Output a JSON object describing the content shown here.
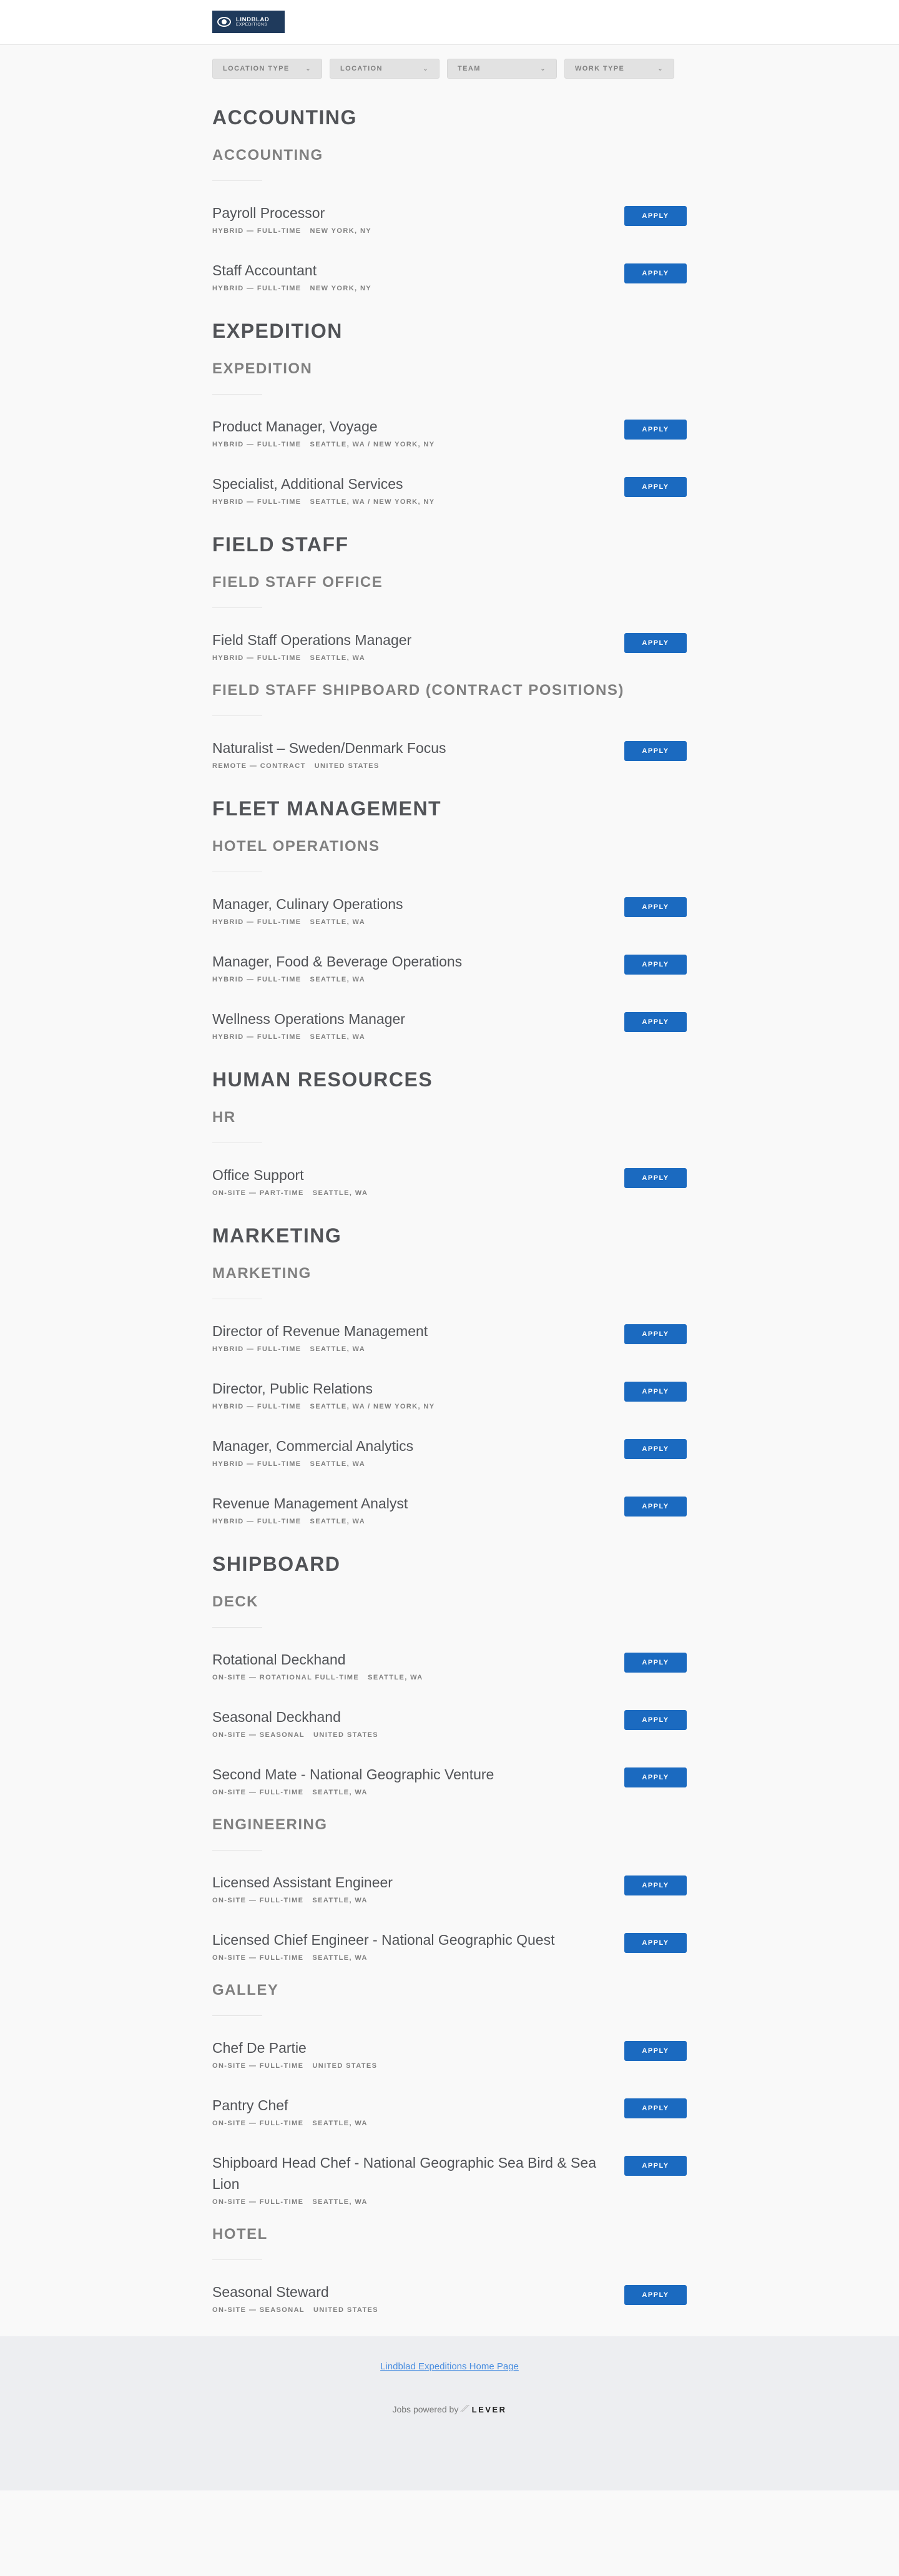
{
  "header": {
    "logo_line1": "LINDBLAD",
    "logo_line2": "EXPEDITIONS"
  },
  "filters": [
    {
      "label": "LOCATION TYPE"
    },
    {
      "label": "LOCATION"
    },
    {
      "label": "TEAM"
    },
    {
      "label": "WORK TYPE"
    }
  ],
  "teams": [
    {
      "name": "ACCOUNTING",
      "depts": [
        {
          "name": "ACCOUNTING",
          "postings": [
            {
              "title": "Payroll Processor",
              "type": "HYBRID — FULL-TIME",
              "location": "NEW YORK, NY"
            },
            {
              "title": "Staff Accountant",
              "type": "HYBRID — FULL-TIME",
              "location": "NEW YORK, NY"
            }
          ]
        }
      ]
    },
    {
      "name": "EXPEDITION",
      "depts": [
        {
          "name": "EXPEDITION",
          "postings": [
            {
              "title": "Product Manager, Voyage",
              "type": "HYBRID — FULL-TIME",
              "location": "SEATTLE, WA / NEW YORK, NY"
            },
            {
              "title": "Specialist, Additional Services",
              "type": "HYBRID — FULL-TIME",
              "location": "SEATTLE, WA / NEW YORK, NY"
            }
          ]
        }
      ]
    },
    {
      "name": "FIELD STAFF",
      "depts": [
        {
          "name": "FIELD STAFF OFFICE",
          "postings": [
            {
              "title": "Field Staff Operations Manager",
              "type": "HYBRID — FULL-TIME",
              "location": "SEATTLE, WA"
            }
          ]
        },
        {
          "name": "FIELD STAFF SHIPBOARD (CONTRACT POSITIONS)",
          "postings": [
            {
              "title": "Naturalist – Sweden/Denmark Focus",
              "type": "REMOTE — CONTRACT",
              "location": "UNITED STATES"
            }
          ]
        }
      ]
    },
    {
      "name": "FLEET MANAGEMENT",
      "depts": [
        {
          "name": "HOTEL OPERATIONS",
          "postings": [
            {
              "title": "Manager, Culinary Operations",
              "type": "HYBRID — FULL-TIME",
              "location": "SEATTLE, WA"
            },
            {
              "title": "Manager, Food & Beverage Operations",
              "type": "HYBRID — FULL-TIME",
              "location": "SEATTLE, WA"
            },
            {
              "title": "Wellness Operations Manager",
              "type": "HYBRID — FULL-TIME",
              "location": "SEATTLE, WA"
            }
          ]
        }
      ]
    },
    {
      "name": "HUMAN RESOURCES",
      "depts": [
        {
          "name": "HR",
          "postings": [
            {
              "title": "Office Support",
              "type": "ON-SITE — PART-TIME",
              "location": "SEATTLE, WA"
            }
          ]
        }
      ]
    },
    {
      "name": "MARKETING",
      "depts": [
        {
          "name": "MARKETING",
          "postings": [
            {
              "title": "Director of Revenue Management",
              "type": "HYBRID — FULL-TIME",
              "location": "SEATTLE, WA"
            },
            {
              "title": "Director, Public Relations",
              "type": "HYBRID — FULL-TIME",
              "location": "SEATTLE, WA / NEW YORK, NY"
            },
            {
              "title": "Manager, Commercial Analytics",
              "type": "HYBRID — FULL-TIME",
              "location": "SEATTLE, WA"
            },
            {
              "title": "Revenue Management Analyst",
              "type": "HYBRID — FULL-TIME",
              "location": "SEATTLE, WA"
            }
          ]
        }
      ]
    },
    {
      "name": "SHIPBOARD",
      "depts": [
        {
          "name": "DECK",
          "postings": [
            {
              "title": "Rotational Deckhand",
              "type": "ON-SITE — ROTATIONAL FULL-TIME",
              "location": "SEATTLE, WA"
            },
            {
              "title": "Seasonal Deckhand",
              "type": "ON-SITE — SEASONAL",
              "location": "UNITED STATES"
            },
            {
              "title": "Second Mate - National Geographic Venture",
              "type": "ON-SITE — FULL-TIME",
              "location": "SEATTLE, WA"
            }
          ]
        },
        {
          "name": "ENGINEERING",
          "postings": [
            {
              "title": "Licensed Assistant Engineer",
              "type": "ON-SITE — FULL-TIME",
              "location": "SEATTLE, WA"
            },
            {
              "title": "Licensed Chief Engineer - National Geographic Quest",
              "type": "ON-SITE — FULL-TIME",
              "location": "SEATTLE, WA"
            }
          ]
        },
        {
          "name": "GALLEY",
          "postings": [
            {
              "title": "Chef De Partie",
              "type": "ON-SITE — FULL-TIME",
              "location": "UNITED STATES"
            },
            {
              "title": "Pantry Chef",
              "type": "ON-SITE — FULL-TIME",
              "location": "SEATTLE, WA"
            },
            {
              "title": "Shipboard Head Chef - National Geographic Sea Bird & Sea Lion",
              "type": "ON-SITE — FULL-TIME",
              "location": "SEATTLE, WA"
            }
          ]
        },
        {
          "name": "HOTEL",
          "postings": [
            {
              "title": "Seasonal Steward",
              "type": "ON-SITE — SEASONAL",
              "location": "UNITED STATES"
            }
          ]
        }
      ]
    }
  ],
  "apply_label": "APPLY",
  "footer": {
    "home_link": "Lindblad Expeditions Home Page",
    "powered_text": "Jobs powered by",
    "lever_word": "LEVER"
  }
}
